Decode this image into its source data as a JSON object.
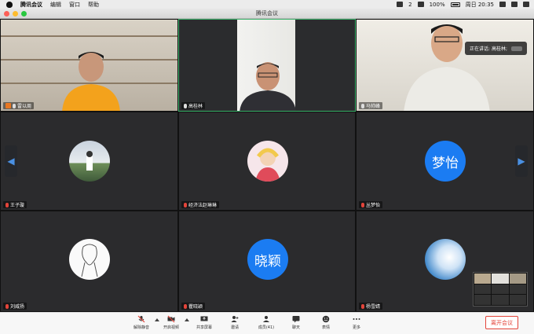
{
  "menubar": {
    "app": "腾讯会议",
    "items": [
      "编辑",
      "窗口",
      "帮助"
    ],
    "notif_count": "2",
    "battery": "100%",
    "clock": "周日 20:35"
  },
  "window": {
    "title": "腾讯会议"
  },
  "participants": [
    {
      "name": "雷以周",
      "muted": false,
      "host": true,
      "kind": "video"
    },
    {
      "name": "高桂林",
      "muted": false,
      "host": false,
      "kind": "video"
    },
    {
      "name": "马帅峰",
      "muted": false,
      "host": false,
      "kind": "video"
    },
    {
      "name": "王子璇",
      "muted": true,
      "host": false,
      "kind": "photo"
    },
    {
      "name": "经济法赵琳琳",
      "muted": true,
      "host": false,
      "kind": "photo"
    },
    {
      "name": "丛梦怡",
      "muted": true,
      "host": false,
      "kind": "text",
      "avatar_text": "梦怡"
    },
    {
      "name": "刘威扬",
      "muted": true,
      "host": false,
      "kind": "photo"
    },
    {
      "name": "瞿晓颖",
      "muted": true,
      "host": false,
      "kind": "text",
      "avatar_text": "晓颖"
    },
    {
      "name": "杨雪婧",
      "muted": true,
      "host": false,
      "kind": "photo"
    }
  ],
  "speaking_tip": "正在讲话: 高桂林;",
  "toolbar": {
    "unmute": "解除静音",
    "video": "开启视频",
    "share": "共享屏幕",
    "invite": "邀请",
    "members": "成员(41)",
    "chat": "聊天",
    "reactions": "表情",
    "more": "更多",
    "leave": "离开会议"
  },
  "colors": {
    "accent": "#1b7cf2",
    "speaking_border": "#3bb36a",
    "leave": "#e3443a",
    "host": "#e87722"
  }
}
